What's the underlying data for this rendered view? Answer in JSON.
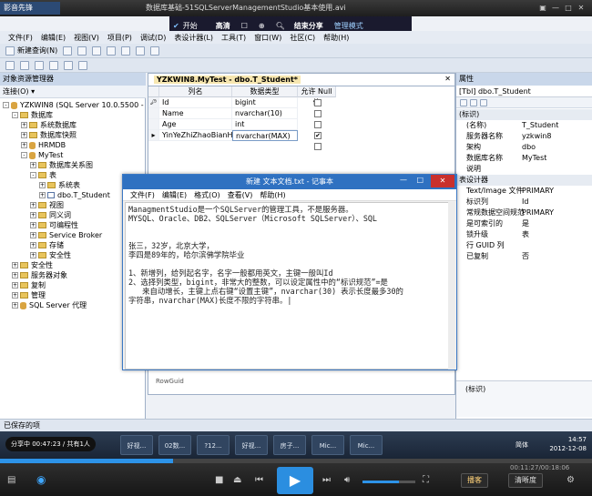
{
  "player": {
    "brand": "影音先锋",
    "title": "数据库基础-51SQLServerManagementStudio基本使用.avi",
    "overlay": {
      "item1": "开始",
      "hd": "高清",
      "end_share": "结束分享",
      "admin": "管理模式"
    },
    "time": "00:11:27/00:18:06",
    "btn_cc": "播客",
    "btn_clear": "清晰度"
  },
  "app": {
    "menu": [
      "文件(F)",
      "编辑(E)",
      "视图(V)",
      "项目(P)",
      "调试(D)",
      "表设计器(L)",
      "工具(T)",
      "窗口(W)",
      "社区(C)",
      "帮助(H)"
    ],
    "toolbar_newquery": "新建查询(N)",
    "status": "已保存的项"
  },
  "explorer": {
    "title": "对象资源管理器",
    "connect": "连接(O) ▾",
    "tree": [
      {
        "indent": 0,
        "ex": "-",
        "icon": "db",
        "text": "YZKWIN8 (SQL Server 10.0.5500 -"
      },
      {
        "indent": 1,
        "ex": "-",
        "icon": "fd",
        "text": "数据库"
      },
      {
        "indent": 2,
        "ex": "+",
        "icon": "fd",
        "text": "系统数据库"
      },
      {
        "indent": 2,
        "ex": "+",
        "icon": "fd",
        "text": "数据库快照"
      },
      {
        "indent": 2,
        "ex": "+",
        "icon": "db",
        "text": "HRMDB"
      },
      {
        "indent": 2,
        "ex": "-",
        "icon": "db",
        "text": "MyTest"
      },
      {
        "indent": 3,
        "ex": "+",
        "icon": "fd",
        "text": "数据库关系图"
      },
      {
        "indent": 3,
        "ex": "-",
        "icon": "fd",
        "text": "表"
      },
      {
        "indent": 4,
        "ex": "+",
        "icon": "fd",
        "text": "系统表"
      },
      {
        "indent": 4,
        "ex": "+",
        "icon": "tbl",
        "text": "dbo.T_Student"
      },
      {
        "indent": 3,
        "ex": "+",
        "icon": "fd",
        "text": "视图"
      },
      {
        "indent": 3,
        "ex": "+",
        "icon": "fd",
        "text": "同义词"
      },
      {
        "indent": 3,
        "ex": "+",
        "icon": "fd",
        "text": "可编程性"
      },
      {
        "indent": 3,
        "ex": "+",
        "icon": "fd",
        "text": "Service Broker"
      },
      {
        "indent": 3,
        "ex": "+",
        "icon": "fd",
        "text": "存储"
      },
      {
        "indent": 3,
        "ex": "+",
        "icon": "fd",
        "text": "安全性"
      },
      {
        "indent": 1,
        "ex": "+",
        "icon": "fd",
        "text": "安全性"
      },
      {
        "indent": 1,
        "ex": "+",
        "icon": "fd",
        "text": "服务器对象"
      },
      {
        "indent": 1,
        "ex": "+",
        "icon": "fd",
        "text": "复制"
      },
      {
        "indent": 1,
        "ex": "+",
        "icon": "fd",
        "text": "管理"
      },
      {
        "indent": 1,
        "ex": "+",
        "icon": "db",
        "text": "SQL Server 代理"
      }
    ]
  },
  "designer": {
    "tab": "YZKWIN8.MyTest - dbo.T_Student*",
    "headers": [
      "列名",
      "数据类型",
      "允许 Null 值"
    ],
    "rows": [
      {
        "name": "Id",
        "type": "bigint",
        "null": false,
        "key": true
      },
      {
        "name": "Name",
        "type": "nvarchar(10)",
        "null": false,
        "key": false
      },
      {
        "name": "Age",
        "type": "int",
        "null": false,
        "key": false
      },
      {
        "name": "YinYeZhiZhaoBianHao",
        "type": "nvarchar(MAX)",
        "null": true,
        "key": false
      }
    ],
    "bottom_label": "RowGuid"
  },
  "notepad": {
    "title": "新建 文本文档.txt - 记事本",
    "menu": [
      "文件(F)",
      "编辑(E)",
      "格式(O)",
      "查看(V)",
      "帮助(H)"
    ],
    "text": "ManagmentStudio是一个SQLServer的管理工具，不是服务器。\nMYSQL、Oracle、DB2、SQLServer（Microsoft SQLServer）、SQL\n\n\n张三，32岁，北京大学，\n李四是89年的，哈尔滨佛学院毕业\n\n1、新增列，给列起名字，名字一般都用英文，主键一般叫Id\n2、选择列类型，bigint，非常大的整数，可以设定属性中的“标识规范”=是\n   来自动增长，主键上点右键“设置主键”，nvarchar(30) 表示长度最多30的\n字符串，nvarchar(MAX)长度不限的字符串。|"
  },
  "properties": {
    "title": "属性",
    "selector": "[Tbl] dbo.T_Student",
    "rows": [
      {
        "cat": true,
        "k": "(标识)",
        "v": ""
      },
      {
        "cat": false,
        "k": "(名称)",
        "v": "T_Student"
      },
      {
        "cat": false,
        "k": "服务器名称",
        "v": "yzkwin8"
      },
      {
        "cat": false,
        "k": "架构",
        "v": "dbo"
      },
      {
        "cat": false,
        "k": "数据库名称",
        "v": "MyTest"
      },
      {
        "cat": false,
        "k": "说明",
        "v": ""
      },
      {
        "cat": true,
        "k": "表设计器",
        "v": ""
      },
      {
        "cat": false,
        "k": "Text/Image 文件",
        "v": "PRIMARY"
      },
      {
        "cat": false,
        "k": "标识列",
        "v": "Id"
      },
      {
        "cat": false,
        "k": "常规数据空间规范",
        "v": "PRIMARY"
      },
      {
        "cat": false,
        "k": "是可索引的",
        "v": "是"
      },
      {
        "cat": false,
        "k": "锁升级",
        "v": "表"
      },
      {
        "cat": false,
        "k": "行 GUID 列",
        "v": ""
      },
      {
        "cat": false,
        "k": "已复制",
        "v": "否"
      }
    ],
    "footer": "(标识)"
  },
  "taskbar": {
    "share": "分享中 00:47:23 / 共有1人",
    "items": [
      "好视...",
      "02数...",
      "?12...",
      "好视...",
      "房子...",
      "Mic...",
      "Mic..."
    ],
    "lang": "简体",
    "time": "14:57",
    "date": "2012-12-08"
  }
}
